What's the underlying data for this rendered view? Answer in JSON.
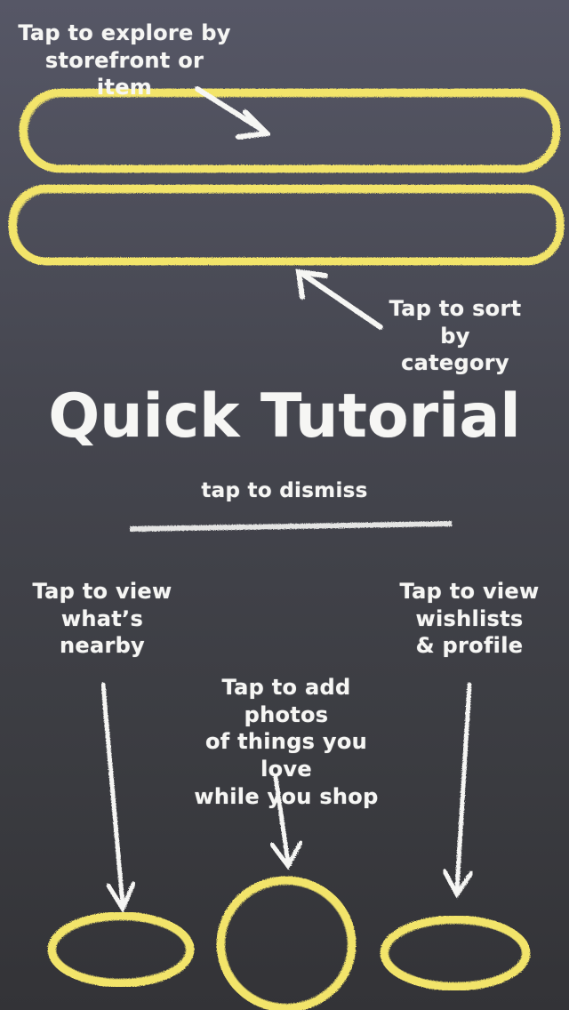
{
  "tutorial": {
    "search_hint": "Tap to explore by\nstorefront or item",
    "category_hint": "Tap to sort\nby category",
    "title": "Quick Tutorial",
    "dismiss": "tap to dismiss",
    "nearby_hint": "Tap to view\nwhat’s\nnearby",
    "photos_hint": "Tap to add photos\nof things you love\nwhile you shop",
    "profile_hint": "Tap to view\nwishlists\n& profile"
  },
  "colors": {
    "chalk_yellow": "#f2e46b",
    "chalk_white": "#f6f6f4",
    "board_top": "#565766",
    "board_bottom": "#333337"
  },
  "icons": {
    "arrow": "chalk-arrow-icon",
    "highlight": "chalk-oval-icon"
  }
}
